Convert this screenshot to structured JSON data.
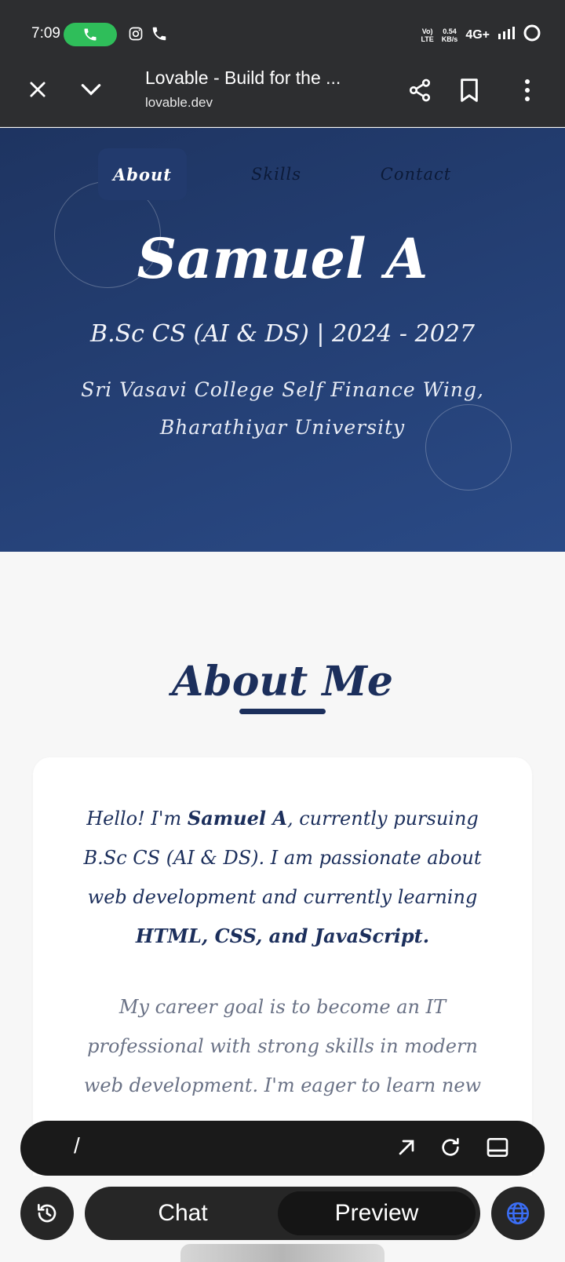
{
  "status_bar": {
    "time": "7:09",
    "volte": "Vo)\nLTE",
    "speed_value": "0.54",
    "speed_unit": "KB/s",
    "network": "4G+"
  },
  "browser": {
    "title": "Lovable - Build for the ...",
    "url": "lovable.dev"
  },
  "nav": {
    "items": [
      {
        "label": "About",
        "active": true
      },
      {
        "label": "Skills",
        "active": false
      },
      {
        "label": "Contact",
        "active": false
      }
    ]
  },
  "hero": {
    "name": "Samuel A",
    "degree": "B.Sc CS (AI & DS) | 2024 - 2027",
    "college": "Sri Vasavi College Self Finance Wing, Bharathiyar University"
  },
  "about": {
    "title": "About Me",
    "p1_pre": "Hello! I'm ",
    "p1_name": "Samuel A",
    "p1_mid": ", currently pursuing B.Sc CS (AI & DS). I am passionate about web development and currently learning ",
    "p1_skills": "HTML, CSS, and JavaScript.",
    "p2": "My career goal is to become an IT professional with strong skills in modern web development. I'm eager to learn new"
  },
  "bottom": {
    "path": "/",
    "chat_label": "Chat",
    "preview_label": "Preview"
  },
  "colors": {
    "hero_bg": "#1e3461",
    "accent_navy": "#1c2f5c",
    "call_green": "#2fbe5a",
    "globe_blue": "#3b6ef5"
  }
}
